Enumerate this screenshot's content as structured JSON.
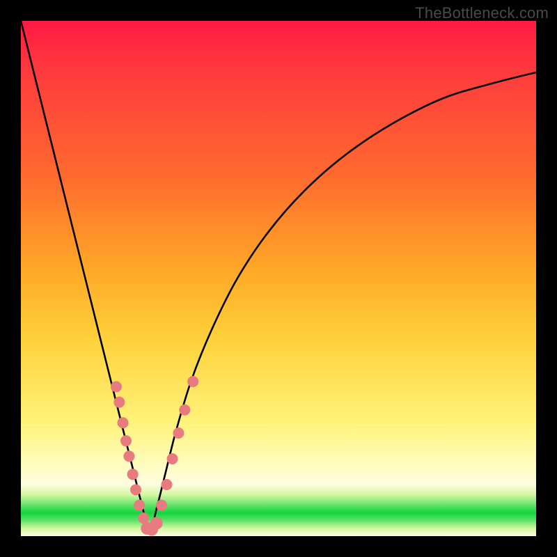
{
  "watermark": {
    "text": "TheBottleneck.com"
  },
  "chart_data": {
    "type": "line",
    "title": "",
    "xlabel": "",
    "ylabel": "",
    "xlim": [
      0,
      100
    ],
    "ylim": [
      0,
      100
    ],
    "series": [
      {
        "name": "bottleneck-curve",
        "x": [
          0,
          3,
          6,
          9,
          12,
          15,
          18,
          20,
          22,
          23.5,
          25,
          26.5,
          28,
          30,
          33,
          37,
          42,
          48,
          55,
          63,
          72,
          82,
          92,
          100
        ],
        "y": [
          100,
          88,
          76,
          64,
          52,
          40,
          28,
          20,
          12,
          6,
          1,
          6,
          12,
          20,
          30,
          40,
          50,
          59,
          67,
          74,
          80,
          85,
          88,
          90
        ]
      }
    ],
    "markers": {
      "name": "sample-points",
      "color": "#e77b7f",
      "points": [
        {
          "x": 18.5,
          "y": 29,
          "r": 8
        },
        {
          "x": 19.1,
          "y": 26,
          "r": 8
        },
        {
          "x": 19.8,
          "y": 22,
          "r": 8
        },
        {
          "x": 20.4,
          "y": 18.5,
          "r": 8
        },
        {
          "x": 21.0,
          "y": 15.5,
          "r": 8
        },
        {
          "x": 21.7,
          "y": 12.0,
          "r": 8
        },
        {
          "x": 22.3,
          "y": 9.0,
          "r": 8
        },
        {
          "x": 23.0,
          "y": 6.0,
          "r": 8
        },
        {
          "x": 23.8,
          "y": 3.5,
          "r": 8
        },
        {
          "x": 24.5,
          "y": 1.5,
          "r": 9
        },
        {
          "x": 25.4,
          "y": 1.3,
          "r": 9
        },
        {
          "x": 26.3,
          "y": 2.5,
          "r": 9
        },
        {
          "x": 27.3,
          "y": 6.0,
          "r": 8
        },
        {
          "x": 28.3,
          "y": 10.0,
          "r": 8
        },
        {
          "x": 29.4,
          "y": 15.0,
          "r": 8
        },
        {
          "x": 30.6,
          "y": 20.0,
          "r": 8
        },
        {
          "x": 31.8,
          "y": 24.5,
          "r": 8
        },
        {
          "x": 33.4,
          "y": 30.0,
          "r": 8
        }
      ]
    },
    "gradient_stops": [
      {
        "pos": 0.0,
        "color": "#ff1a44"
      },
      {
        "pos": 0.3,
        "color": "#ff6a2f"
      },
      {
        "pos": 0.62,
        "color": "#ffd23b"
      },
      {
        "pos": 0.86,
        "color": "#fffcbe"
      },
      {
        "pos": 0.955,
        "color": "#16d440"
      },
      {
        "pos": 1.0,
        "color": "#fffde0"
      }
    ]
  }
}
